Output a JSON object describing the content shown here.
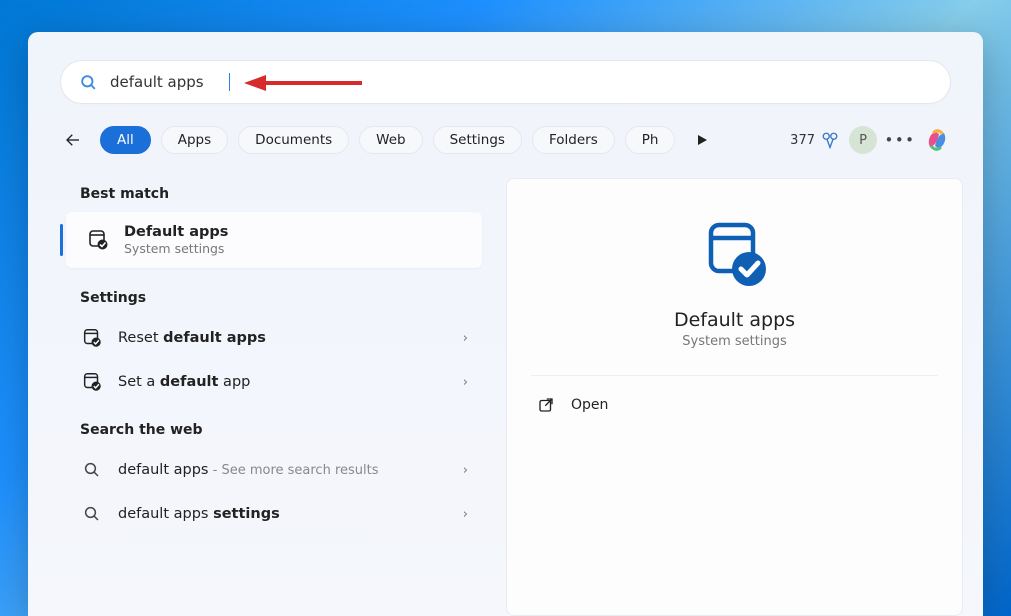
{
  "search": {
    "value": "default apps"
  },
  "filters": {
    "all": "All",
    "apps": "Apps",
    "documents": "Documents",
    "web": "Web",
    "settings": "Settings",
    "folders": "Folders",
    "photos_partial": "Ph"
  },
  "topbar": {
    "rewards_count": "377",
    "avatar_initial": "P"
  },
  "left": {
    "best_match_header": "Best match",
    "best_match": {
      "title": "Default apps",
      "subtitle": "System settings"
    },
    "settings_header": "Settings",
    "settings_items": [
      {
        "prefix": "Reset ",
        "bold": "default apps",
        "suffix": ""
      },
      {
        "prefix": "Set a ",
        "bold": "default",
        "suffix": " app"
      }
    ],
    "web_header": "Search the web",
    "web_items": [
      {
        "text": "default apps",
        "hint": " - See more search results"
      },
      {
        "prefix": "default apps ",
        "bold": "settings",
        "suffix": ""
      }
    ]
  },
  "right": {
    "title": "Default apps",
    "subtitle": "System settings",
    "open_label": "Open"
  },
  "chevron_glyph": "›"
}
